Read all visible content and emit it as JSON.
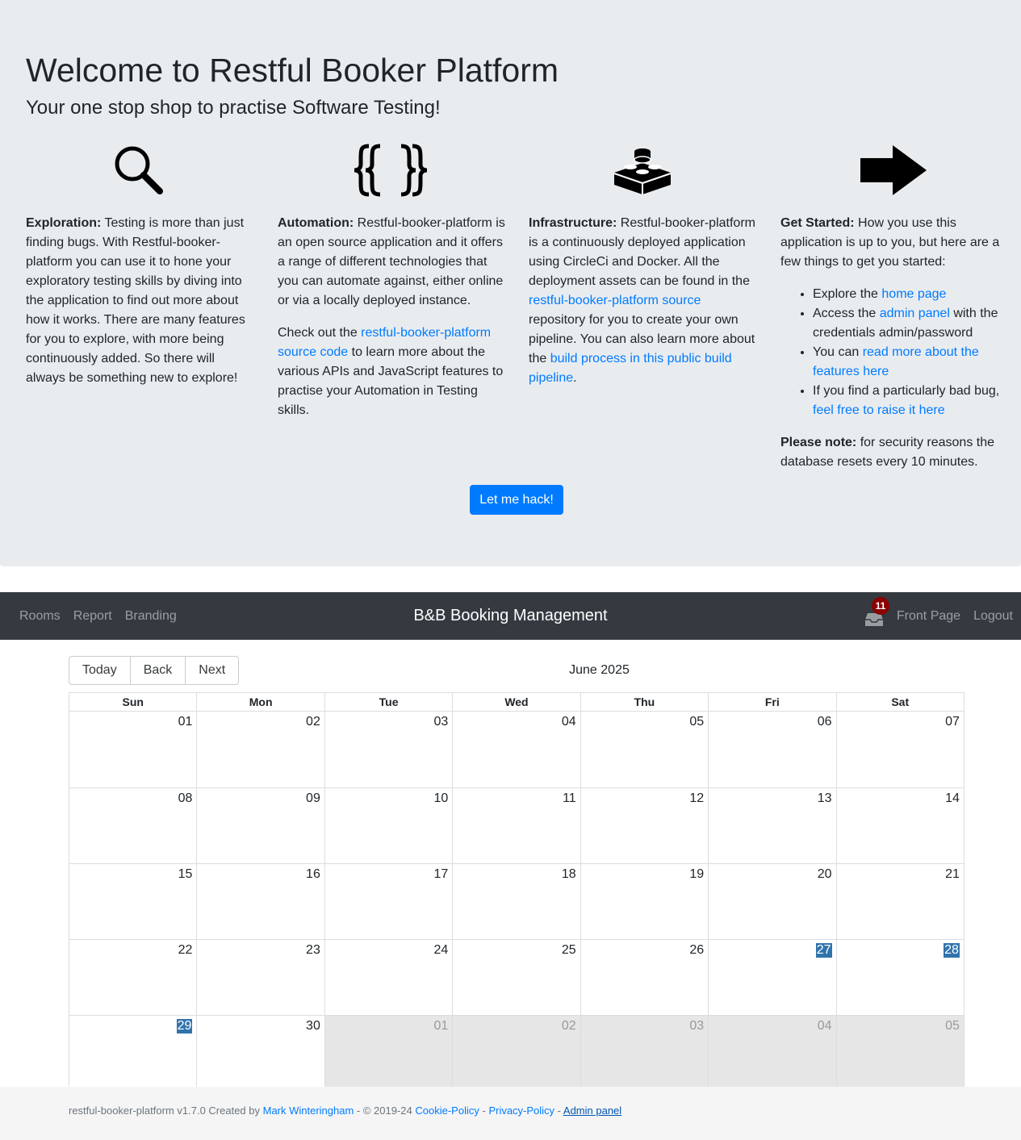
{
  "hero": {
    "title": "Welcome to Restful Booker Platform",
    "subtitle": "Your one stop shop to practise Software Testing!",
    "exploration": {
      "icon": "search-icon",
      "heading": "Exploration:",
      "text": " Testing is more than just finding bugs. With Restful-booker-platform you can use it to hone your exploratory testing skills by diving into the application to find out more about how it works. There are many features for you to explore, with more being continuously added. So there will always be something new to explore!"
    },
    "automation": {
      "icon": "code-braces-icon",
      "heading": "Automation:",
      "text": " Restful-booker-platform is an open source application and it offers a range of different technologies that you can automate against, either online or via a locally deployed instance.",
      "p2_before": "Check out the ",
      "p2_link": "restful-booker-platform source code",
      "p2_after": " to learn more about the various APIs and JavaScript features to practise your Automation in Testing skills."
    },
    "infrastructure": {
      "icon": "lego-brick-icon",
      "heading": "Infrastructure:",
      "text1": " Restful-booker-platform is a continuously deployed application using CircleCi and Docker. All the deployment assets can be found in the ",
      "link1": "restful-booker-platform source",
      "text2": " repository for you to create your own pipeline. You can also learn more about the ",
      "link2": "build process in this public build pipeline",
      "text3": "."
    },
    "get_started": {
      "icon": "arrow-right-icon",
      "heading": "Get Started:",
      "text": " How you use this application is up to you, but here are a few things to get you started:",
      "li1_before": "Explore the ",
      "li1_link": "home page",
      "li2_before": "Access the ",
      "li2_link": "admin panel",
      "li2_after": " with the credentials admin/password",
      "li3_before": "You can ",
      "li3_link": "read more about the features here",
      "li4_before": "If you find a particularly bad bug, ",
      "li4_link": "feel free to raise it here",
      "note_heading": "Please note:",
      "note_text": " for security reasons the database resets every 10 minutes."
    },
    "hack_button": "Let me hack!"
  },
  "navbar": {
    "rooms": "Rooms",
    "report": "Report",
    "branding": "Branding",
    "brand": "B&B Booking Management",
    "notification_icon": "inbox-icon",
    "notification_count": "11",
    "front_page": "Front Page",
    "logout": "Logout"
  },
  "calendar": {
    "today": "Today",
    "back": "Back",
    "next": "Next",
    "label": "June 2025",
    "weekdays": [
      "Sun",
      "Mon",
      "Tue",
      "Wed",
      "Thu",
      "Fri",
      "Sat"
    ],
    "weeks": [
      [
        {
          "d": "01"
        },
        {
          "d": "02"
        },
        {
          "d": "03"
        },
        {
          "d": "04"
        },
        {
          "d": "05"
        },
        {
          "d": "06"
        },
        {
          "d": "07"
        }
      ],
      [
        {
          "d": "08"
        },
        {
          "d": "09"
        },
        {
          "d": "10"
        },
        {
          "d": "11"
        },
        {
          "d": "12"
        },
        {
          "d": "13"
        },
        {
          "d": "14"
        }
      ],
      [
        {
          "d": "15"
        },
        {
          "d": "16"
        },
        {
          "d": "17"
        },
        {
          "d": "18"
        },
        {
          "d": "19"
        },
        {
          "d": "20"
        },
        {
          "d": "21"
        }
      ],
      [
        {
          "d": "22"
        },
        {
          "d": "23"
        },
        {
          "d": "24"
        },
        {
          "d": "25"
        },
        {
          "d": "26"
        },
        {
          "d": "27",
          "sel": true
        },
        {
          "d": "28",
          "sel": true
        }
      ],
      [
        {
          "d": "29",
          "sel": true
        },
        {
          "d": "30"
        },
        {
          "d": "01",
          "off": true
        },
        {
          "d": "02",
          "off": true
        },
        {
          "d": "03",
          "off": true
        },
        {
          "d": "04",
          "off": true
        },
        {
          "d": "05",
          "off": true
        }
      ]
    ],
    "selection_color": "#3174ad"
  },
  "footer": {
    "text1": "restful-booker-platform v1.7.0 Created by ",
    "author": "Mark Winteringham",
    "text2": " - © 2019-24 ",
    "cookie": "Cookie-Policy",
    "sep1": " - ",
    "privacy": "Privacy-Policy",
    "sep2": " - ",
    "admin": "Admin panel"
  }
}
